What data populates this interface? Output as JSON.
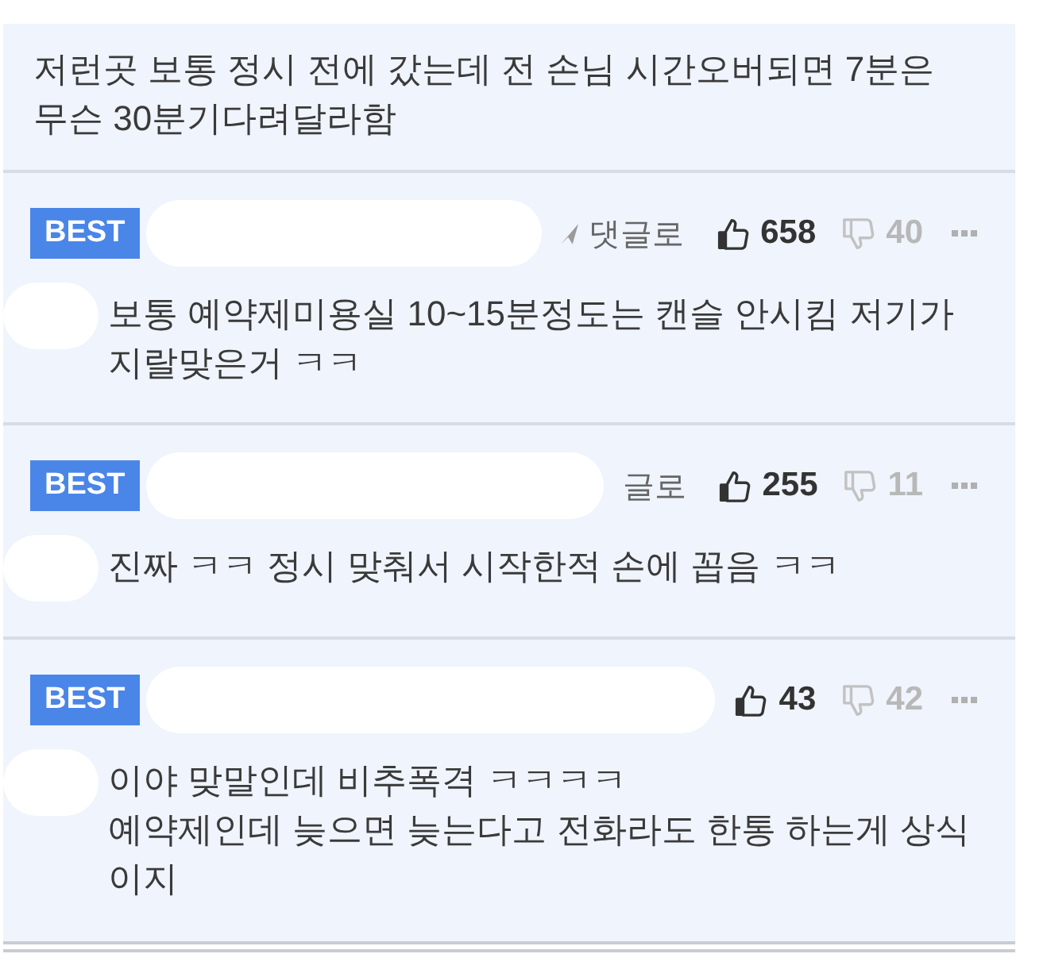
{
  "top_comment": {
    "text": "저런곳 보통 정시 전에 갔는데 전 손님 시간오버되면 7분은 무슨 30분기다려달라함"
  },
  "comments": [
    {
      "badge": "BEST",
      "reply": {
        "label": "댓글로",
        "icon": true
      },
      "likes": "658",
      "dislikes": "40",
      "text": "보통 예약제미용실 10~15분정도는 캔슬 안시킴 저기가 지랄맞은거 ㅋㅋ"
    },
    {
      "badge": "BEST",
      "reply": {
        "label": "글로",
        "icon": false
      },
      "likes": "255",
      "dislikes": "11",
      "text": "진짜 ㅋㅋ 정시 맞춰서 시작한적 손에 꼽음 ㅋㅋ"
    },
    {
      "badge": "BEST",
      "likes": "43",
      "dislikes": "42",
      "text": "이야 맞말인데 비추폭격 ㅋㅋㅋㅋ\n예약제인데 늦으면 늦는다고 전화라도 한통 하는게 상식이지"
    }
  ]
}
